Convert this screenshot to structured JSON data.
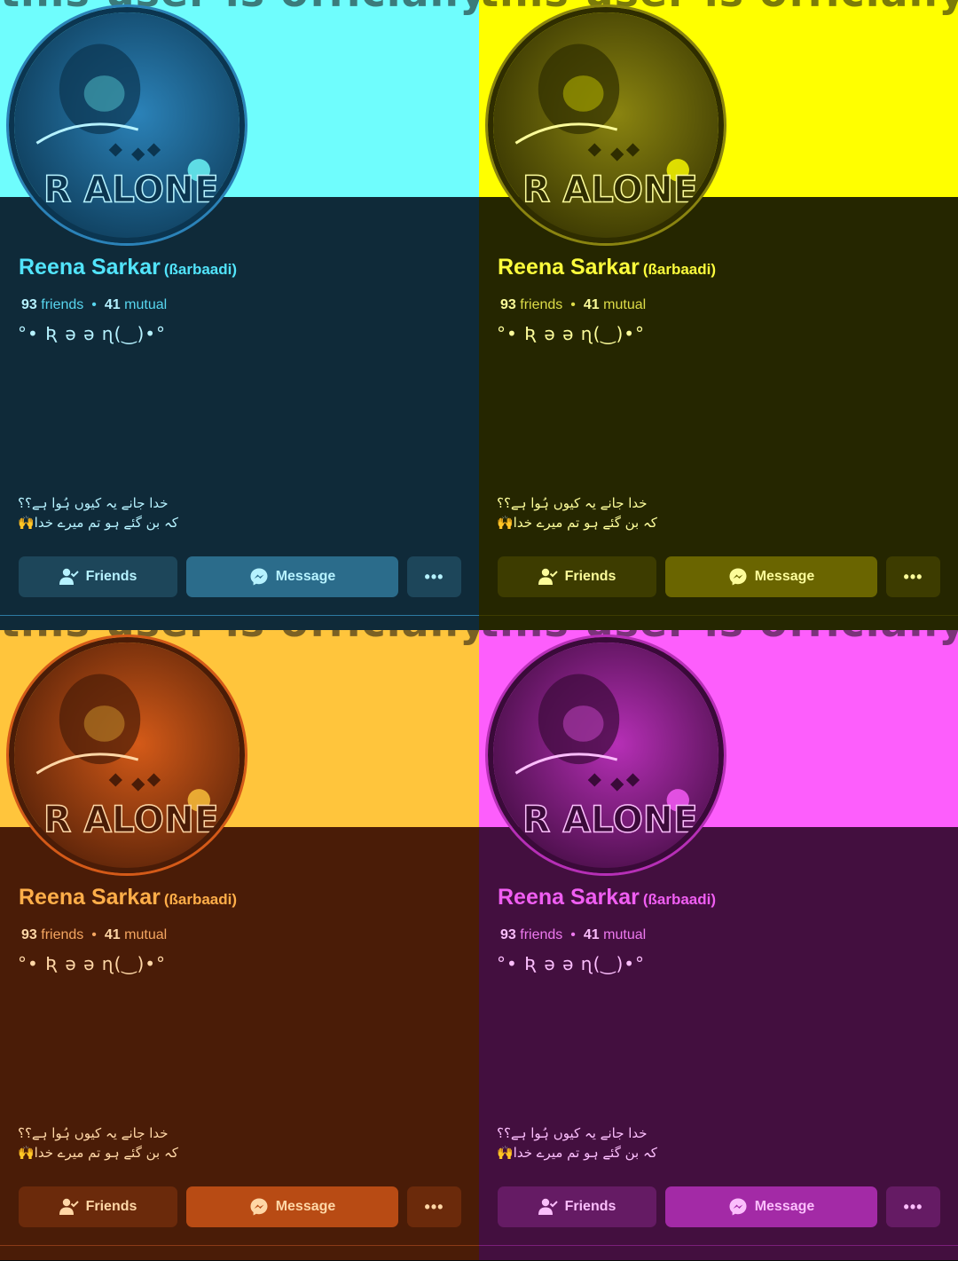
{
  "cover_caption": "this user is officially rude.",
  "avatar_text": "R ALONE",
  "profile": {
    "name": "Reena Sarkar",
    "nickname": "(ßarbaadi)",
    "friends_count": "93",
    "friends_label": "friends",
    "separator": "•",
    "mutual_count": "41",
    "mutual_label": "mutual",
    "bio": "°• Ʀ ə ə ɳ(‿)•°",
    "urdu_line_1": "خدا جانے یہ کیوں ہُوا ہے؟؟",
    "urdu_line_2": "کہ بن گئے ہو تم میرے خدا🙌"
  },
  "buttons": {
    "friends_label": "Friends",
    "message_label": "Message",
    "more_label": "•••"
  },
  "icons": {
    "friends": "friends-person-check-icon",
    "message": "messenger-icon",
    "more": "more-options-icon"
  },
  "themes": [
    {
      "cover": "#6ffdfd",
      "body": "#0f2a39",
      "accent": "#52e4fb",
      "text": "#58d6ef",
      "btn": "#1d465a",
      "btn_primary": "#2b6c8b",
      "btn_text": "#b6f2ff",
      "line": "#2d7aa2",
      "tint": "#2b82b8",
      "tint_dark": "#0b3550"
    },
    {
      "cover": "#ffff00",
      "body": "#252600",
      "accent": "#fcfc3c",
      "text": "#dddc48",
      "btn": "#3d3c00",
      "btn_primary": "#6a6500",
      "btn_text": "#fcfc9a",
      "line": "#3d3c00",
      "tint": "#8a8410",
      "tint_dark": "#2f2d00"
    },
    {
      "cover": "#ffc53c",
      "body": "#4a1c07",
      "accent": "#ffae49",
      "text": "#f4a661",
      "btn": "#6b2a0b",
      "btn_primary": "#b84b14",
      "btn_text": "#ffd7a6",
      "line": "#8a3a18",
      "tint": "#d45a18",
      "tint_dark": "#4a1c07"
    },
    {
      "cover": "#fd5efc",
      "body": "#430f3f",
      "accent": "#f05ef2",
      "text": "#ed79ef",
      "btn": "#651b64",
      "btn_primary": "#a32aa6",
      "btn_text": "#fbbefc",
      "line": "#7a1f79",
      "tint": "#b62fb6",
      "tint_dark": "#3a0a39"
    }
  ]
}
